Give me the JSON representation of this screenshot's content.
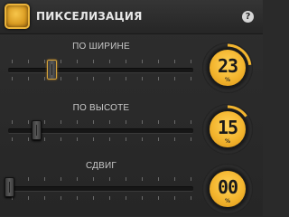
{
  "header": {
    "title": "ПИКСЕЛИЗАЦИЯ",
    "help_glyph": "?"
  },
  "controls": [
    {
      "label": "ПО ШИРИНЕ",
      "value": "23",
      "unit": "%",
      "level": 0.23,
      "active": true
    },
    {
      "label": "ПО ВЫСОТЕ",
      "value": "15",
      "unit": "%",
      "level": 0.15,
      "active": false
    },
    {
      "label": "СДВИГ",
      "value": "00",
      "unit": "%",
      "level": 0.0,
      "active": false
    }
  ],
  "colors": {
    "accent": "#f3b52e",
    "background": "#2a2a2a"
  },
  "icons": {
    "toggle": "enable-toggle-icon",
    "help": "help-icon"
  }
}
